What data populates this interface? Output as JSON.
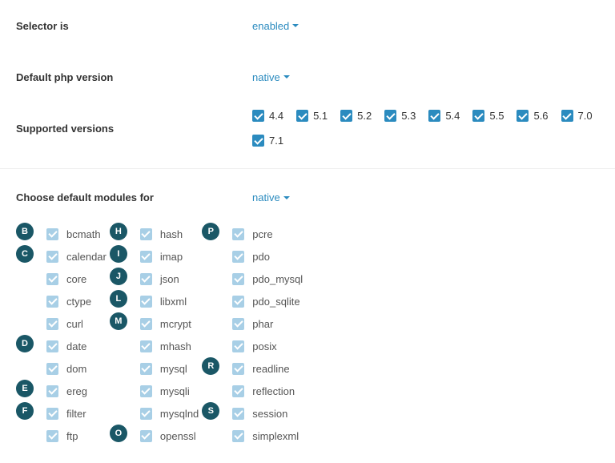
{
  "selector": {
    "label": "Selector is",
    "value": "enabled"
  },
  "defaultPhp": {
    "label": "Default php version",
    "value": "native"
  },
  "supported": {
    "label": "Supported versions",
    "versions": [
      "4.4",
      "5.1",
      "5.2",
      "5.3",
      "5.4",
      "5.5",
      "5.6",
      "7.0",
      "7.1"
    ]
  },
  "modulesHeader": {
    "label": "Choose default modules for",
    "value": "native"
  },
  "col1": {
    "letters": [
      "B",
      "C",
      "",
      "",
      "",
      "D",
      "",
      "E",
      "F",
      ""
    ],
    "items": [
      "bcmath",
      "calendar",
      "core",
      "ctype",
      "curl",
      "date",
      "dom",
      "ereg",
      "filter",
      "ftp"
    ]
  },
  "col2": {
    "letters": [
      "H",
      "I",
      "J",
      "L",
      "M",
      "",
      "",
      "",
      "",
      "O"
    ],
    "items": [
      "hash",
      "imap",
      "json",
      "libxml",
      "mcrypt",
      "mhash",
      "mysql",
      "mysqli",
      "mysqlnd",
      "openssl"
    ]
  },
  "col3": {
    "letters": [
      "P",
      "",
      "",
      "",
      "",
      "",
      "R",
      "",
      "S",
      ""
    ],
    "items": [
      "pcre",
      "pdo",
      "pdo_mysql",
      "pdo_sqlite",
      "phar",
      "posix",
      "readline",
      "reflection",
      "session",
      "simplexml"
    ]
  }
}
